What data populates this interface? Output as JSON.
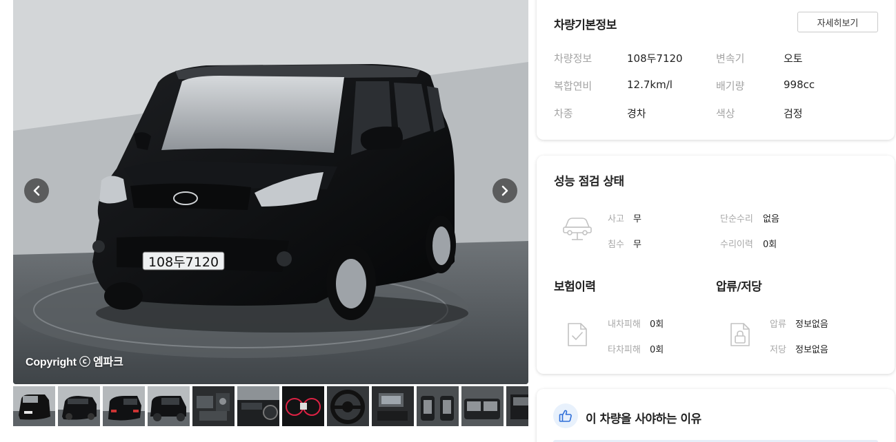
{
  "gallery": {
    "prev_icon": "chevron-left-icon",
    "next_icon": "chevron-right-icon",
    "copyright": "Copyright ⓒ 엠파크",
    "plate": "108두7120",
    "thumbnails": [
      {
        "name": "thumb-front-left"
      },
      {
        "name": "thumb-rear-right"
      },
      {
        "name": "thumb-rear-left"
      },
      {
        "name": "thumb-side-left"
      },
      {
        "name": "thumb-engine"
      },
      {
        "name": "thumb-interior-dash"
      },
      {
        "name": "thumb-gauge-cluster"
      },
      {
        "name": "thumb-steering-wheel"
      },
      {
        "name": "thumb-center-console"
      },
      {
        "name": "thumb-front-seats"
      },
      {
        "name": "thumb-rear-seats"
      },
      {
        "name": "thumb-trunk"
      }
    ]
  },
  "basic_info": {
    "title": "차량기본정보",
    "detail_button": "자세히보기",
    "rows": [
      {
        "label1": "차량정보",
        "value1": "108두7120",
        "label2": "변속기",
        "value2": "오토"
      },
      {
        "label1": "복합연비",
        "value1": "12.7km/l",
        "label2": "배기량",
        "value2": "998cc"
      },
      {
        "label1": "차종",
        "value1": "경차",
        "label2": "색상",
        "value2": "검정"
      }
    ]
  },
  "performance": {
    "title": "성능 점검 상태",
    "accident_label": "사고",
    "accident_value": "무",
    "simple_repair_label": "단순수리",
    "simple_repair_value": "없음",
    "flood_label": "침수",
    "flood_value": "무",
    "repair_history_label": "수리이력",
    "repair_history_value": "0회",
    "insurance_title": "보험이력",
    "own_damage_label": "내차피해",
    "own_damage_value": "0회",
    "other_damage_label": "타차피해",
    "other_damage_value": "0회",
    "seizure_title": "압류/저당",
    "seizure_label": "압류",
    "seizure_value": "정보없음",
    "mortgage_label": "저당",
    "mortgage_value": "정보없음"
  },
  "reason": {
    "title": "이 차량을 사야하는 이유"
  },
  "colors": {
    "accent": "#2f6fd8",
    "label_gray": "#a3a3a3",
    "card_border": "#e2e2e2"
  }
}
